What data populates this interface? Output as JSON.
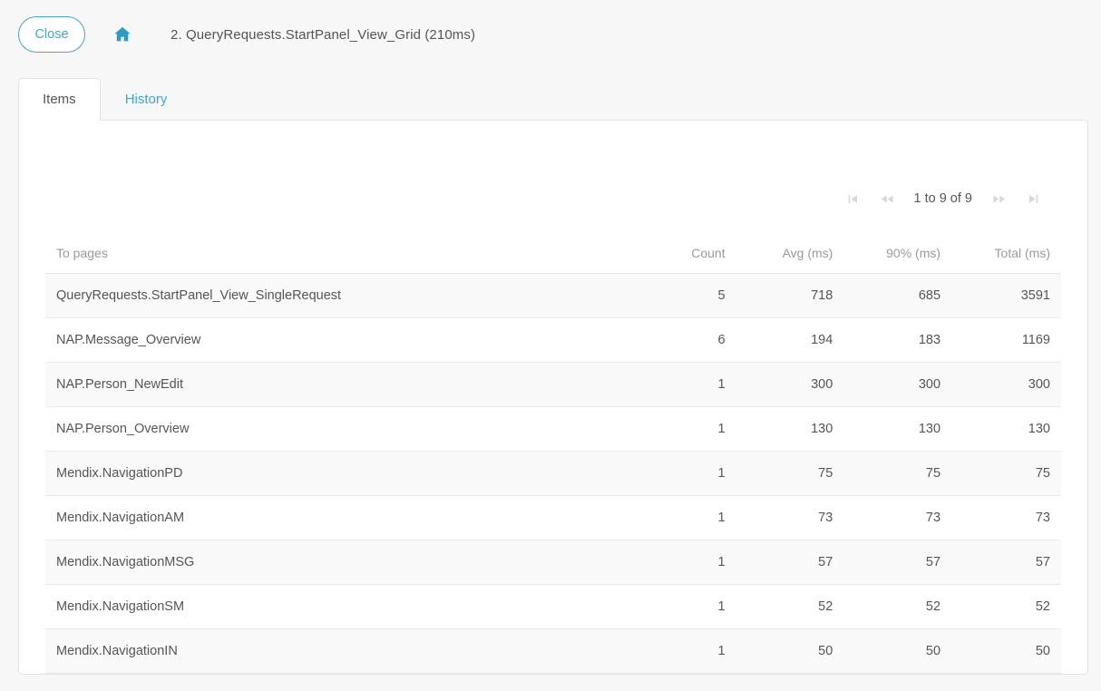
{
  "header": {
    "close_label": "Close",
    "home_icon": "home-icon",
    "title": "2. QueryRequests.StartPanel_View_Grid (210ms)",
    "accent_color": "#4aa3c0",
    "home_icon_color": "#2c9cc4"
  },
  "tabs": [
    {
      "label": "Items",
      "active": true
    },
    {
      "label": "History",
      "active": false
    }
  ],
  "pagination": {
    "first_icon": "first-page-icon",
    "previous_icon": "previous-page-icon",
    "status": "1 to 9 of 9",
    "next_icon": "next-page-icon",
    "last_icon": "last-page-icon",
    "icon_color": "#d6d6d6"
  },
  "table": {
    "columns": [
      "To pages",
      "Count",
      "Avg (ms)",
      "90% (ms)",
      "Total (ms)"
    ],
    "rows": [
      {
        "name": "QueryRequests.StartPanel_View_SingleRequest",
        "count": "5",
        "avg": "718",
        "p90": "685",
        "total": "3591"
      },
      {
        "name": "NAP.Message_Overview",
        "count": "6",
        "avg": "194",
        "p90": "183",
        "total": "1169"
      },
      {
        "name": "NAP.Person_NewEdit",
        "count": "1",
        "avg": "300",
        "p90": "300",
        "total": "300"
      },
      {
        "name": "NAP.Person_Overview",
        "count": "1",
        "avg": "130",
        "p90": "130",
        "total": "130"
      },
      {
        "name": "Mendix.NavigationPD",
        "count": "1",
        "avg": "75",
        "p90": "75",
        "total": "75"
      },
      {
        "name": "Mendix.NavigationAM",
        "count": "1",
        "avg": "73",
        "p90": "73",
        "total": "73"
      },
      {
        "name": "Mendix.NavigationMSG",
        "count": "1",
        "avg": "57",
        "p90": "57",
        "total": "57"
      },
      {
        "name": "Mendix.NavigationSM",
        "count": "1",
        "avg": "52",
        "p90": "52",
        "total": "52"
      },
      {
        "name": "Mendix.NavigationIN",
        "count": "1",
        "avg": "50",
        "p90": "50",
        "total": "50"
      }
    ]
  }
}
